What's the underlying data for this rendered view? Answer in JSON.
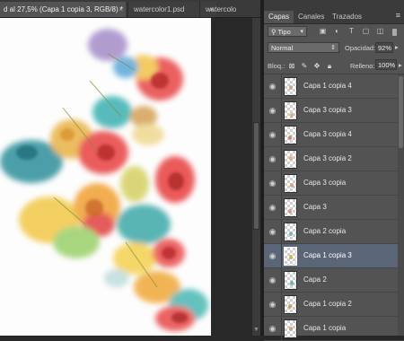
{
  "document_tabs": [
    {
      "label": "d al 27,5% (Capa 1 copia 3, RGB/8) *",
      "close": "×",
      "active": true
    },
    {
      "label": "watercolor1.psd",
      "close": "×",
      "active": false
    },
    {
      "label": "watercolo",
      "close": "",
      "active": false
    }
  ],
  "panel": {
    "tabs": [
      "Capas",
      "Canales",
      "Trazados"
    ],
    "menu_glyph": "≡",
    "filter_kind": "Tipo",
    "blend_mode": "Normal",
    "opacity_label": "Opacidad:",
    "opacity_value": "92%",
    "lock_label": "Bloq.:",
    "fill_label": "Relleno:",
    "fill_value": "100%"
  },
  "layers": [
    {
      "name": "Capa 1 copia 4",
      "selected": false,
      "dot_color": "#d9a08c"
    },
    {
      "name": "Capa 3 copia 3",
      "selected": false,
      "dot_color": "#e0b070"
    },
    {
      "name": "Capa 3 copia 4",
      "selected": false,
      "dot_color": "#d08a6a"
    },
    {
      "name": "Capa 3 copia 2",
      "selected": false,
      "dot_color": "#e8b080"
    },
    {
      "name": "Capa 3 copia",
      "selected": false,
      "dot_color": "#dca57a"
    },
    {
      "name": "Capa 3",
      "selected": false,
      "dot_color": "#d89c7c"
    },
    {
      "name": "Capa 2 copia",
      "selected": false,
      "dot_color": "#78b8c0"
    },
    {
      "name": "Capa 1 copia 3",
      "selected": true,
      "dot_color": "#d4b060"
    },
    {
      "name": "Capa 2",
      "selected": false,
      "dot_color": "#6ab4b8"
    },
    {
      "name": "Capa 1 copia 2",
      "selected": false,
      "dot_color": "#c8a070"
    },
    {
      "name": "Capa 1 copia",
      "selected": false,
      "dot_color": "#d0a878"
    }
  ],
  "colors": {
    "panel_bg": "#535353",
    "selected_layer": "#5a6678",
    "canvas_bg": "#fdfdfd"
  }
}
